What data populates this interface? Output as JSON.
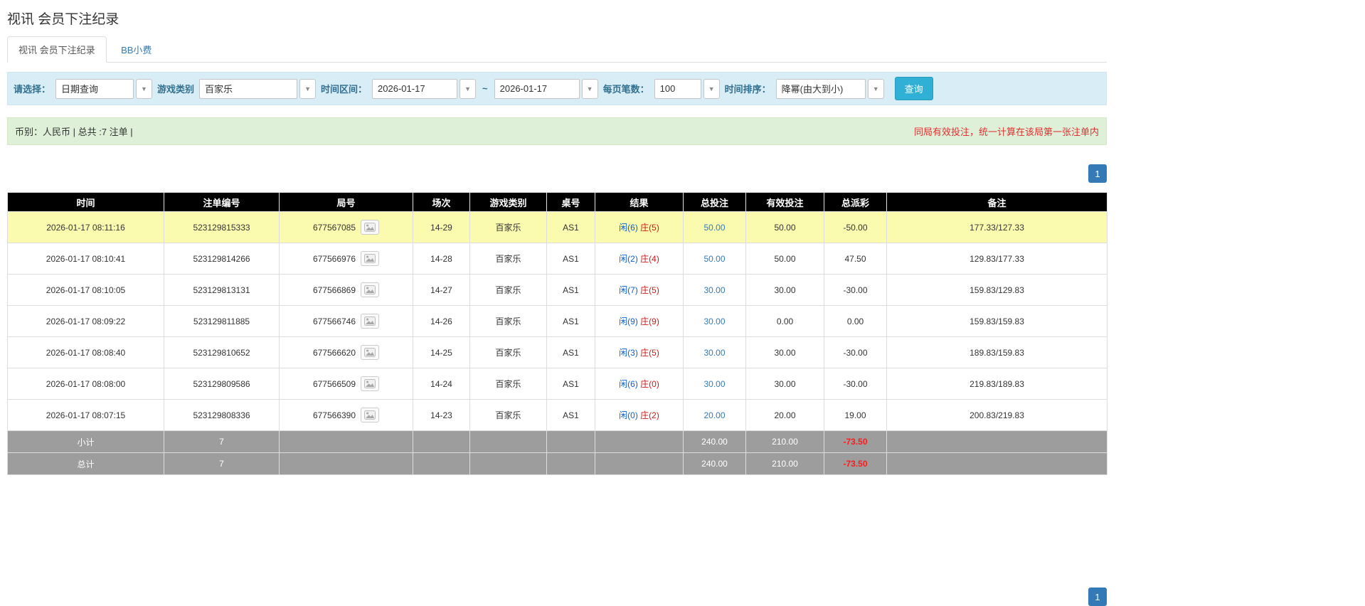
{
  "page": {
    "title": "视讯 会员下注纪录"
  },
  "tabs": [
    {
      "label": "视讯 会员下注纪录",
      "active": true
    },
    {
      "label": "BB小费",
      "active": false
    }
  ],
  "filters": {
    "select_label": "请选择：",
    "select_value": "日期查询",
    "game_type_label": "游戏类别",
    "game_type_value": "百家乐",
    "date_range_label": "时间区间：",
    "date_from": "2026-01-17",
    "date_separator": "~",
    "date_to": "2026-01-17",
    "page_size_label": "每页笔数：",
    "page_size_value": "100",
    "sort_label": "时间排序：",
    "sort_value": "降幂(由大到小)",
    "search_button": "查询"
  },
  "info_bar": {
    "summary": "币别：人民币 | 总共 :7 注单 |",
    "notice": "同局有效投注，统一计算在该局第一张注单内"
  },
  "pagination": {
    "page": "1"
  },
  "table": {
    "headers": [
      "时间",
      "注单编号",
      "局号",
      "场次",
      "游戏类别",
      "桌号",
      "结果",
      "总投注",
      "有效投注",
      "总派彩",
      "备注"
    ],
    "rows": [
      {
        "time": "2026-01-17 08:11:16",
        "bet_id": "523129815333",
        "round_id": "677567085",
        "session": "14-29",
        "game": "百家乐",
        "table_no": "AS1",
        "player": "闲(6)",
        "banker": "庄(5)",
        "total_bet": "50.00",
        "valid_bet": "50.00",
        "payout": "-50.00",
        "note": "177.33/127.33",
        "highlighted": true
      },
      {
        "time": "2026-01-17 08:10:41",
        "bet_id": "523129814266",
        "round_id": "677566976",
        "session": "14-28",
        "game": "百家乐",
        "table_no": "AS1",
        "player": "闲(2)",
        "banker": "庄(4)",
        "total_bet": "50.00",
        "valid_bet": "50.00",
        "payout": "47.50",
        "note": "129.83/177.33",
        "highlighted": false
      },
      {
        "time": "2026-01-17 08:10:05",
        "bet_id": "523129813131",
        "round_id": "677566869",
        "session": "14-27",
        "game": "百家乐",
        "table_no": "AS1",
        "player": "闲(7)",
        "banker": "庄(5)",
        "total_bet": "30.00",
        "valid_bet": "30.00",
        "payout": "-30.00",
        "note": "159.83/129.83",
        "highlighted": false
      },
      {
        "time": "2026-01-17 08:09:22",
        "bet_id": "523129811885",
        "round_id": "677566746",
        "session": "14-26",
        "game": "百家乐",
        "table_no": "AS1",
        "player": "闲(9)",
        "banker": "庄(9)",
        "total_bet": "30.00",
        "valid_bet": "0.00",
        "payout": "0.00",
        "note": "159.83/159.83",
        "highlighted": false
      },
      {
        "time": "2026-01-17 08:08:40",
        "bet_id": "523129810652",
        "round_id": "677566620",
        "session": "14-25",
        "game": "百家乐",
        "table_no": "AS1",
        "player": "闲(3)",
        "banker": "庄(5)",
        "total_bet": "30.00",
        "valid_bet": "30.00",
        "payout": "-30.00",
        "note": "189.83/159.83",
        "highlighted": false
      },
      {
        "time": "2026-01-17 08:08:00",
        "bet_id": "523129809586",
        "round_id": "677566509",
        "session": "14-24",
        "game": "百家乐",
        "table_no": "AS1",
        "player": "闲(6)",
        "banker": "庄(0)",
        "total_bet": "30.00",
        "valid_bet": "30.00",
        "payout": "-30.00",
        "note": "219.83/189.83",
        "highlighted": false
      },
      {
        "time": "2026-01-17 08:07:15",
        "bet_id": "523129808336",
        "round_id": "677566390",
        "session": "14-23",
        "game": "百家乐",
        "table_no": "AS1",
        "player": "闲(0)",
        "banker": "庄(2)",
        "total_bet": "20.00",
        "valid_bet": "20.00",
        "payout": "19.00",
        "note": "200.83/219.83",
        "highlighted": false
      }
    ],
    "footer_rows": [
      {
        "label": "小计",
        "count": "7",
        "total_bet": "240.00",
        "valid_bet": "210.00",
        "payout": "-73.50"
      },
      {
        "label": "总计",
        "count": "7",
        "total_bet": "240.00",
        "valid_bet": "210.00",
        "payout": "-73.50"
      }
    ]
  }
}
